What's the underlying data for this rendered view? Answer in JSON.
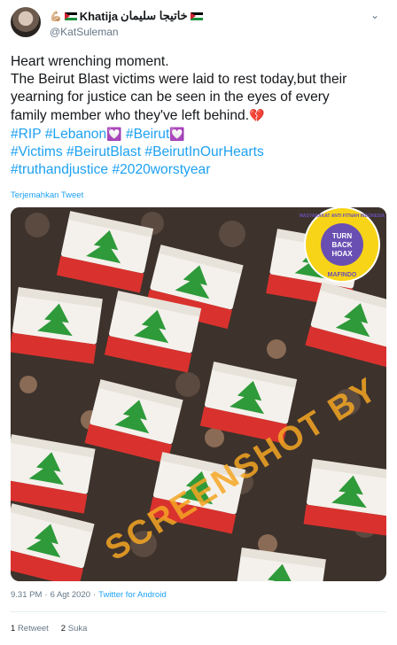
{
  "user": {
    "display_name": "Khatija",
    "display_name_arabic": "خاتيجا سليمان",
    "handle": "@KatSuleman"
  },
  "tweet": {
    "lines": [
      "Heart wrenching moment.",
      "The Beirut Blast victims were laid to rest today,but their",
      "yearning for justice can be seen in the eyes of every",
      "family member who they've left behind."
    ],
    "hashtags_line1": [
      "#RIP",
      "#Lebanon",
      "#Beirut"
    ],
    "hashtags_line2": [
      "#Victims",
      "#BeirutBlast",
      "#BeirutInOurHearts"
    ],
    "hashtags_line3": [
      "#truthandjustice",
      "#2020worstyear"
    ],
    "translate_label": "Terjemahkan Tweet"
  },
  "media": {
    "watermark": "SCREENSHOT BY",
    "stamp_ring_text": "MASYARAKAT ANTI FITNAH INDONESIA",
    "stamp_center": [
      "TURN",
      "BACK",
      "HOAX"
    ],
    "stamp_bottom": "MAFINDO",
    "colors": {
      "watermark": "#f5a623",
      "stamp": "#f7d417",
      "stamp_inner": "#6a4fb3",
      "cedar": "#2e9a3a",
      "flag_red": "#d9322e"
    }
  },
  "meta": {
    "time": "9.31 PM",
    "date": "6 Agt 2020",
    "client": "Twitter for Android"
  },
  "stats": {
    "retweets_count": "1",
    "retweets_label": "Retweet",
    "likes_count": "2",
    "likes_label": "Suka"
  },
  "icons": [
    "avatar",
    "palestine-flag-icon",
    "strong-arm-emoji-icon",
    "chevron-down-icon",
    "broken-heart-icon",
    "heart-emoji-icon",
    "lebanon-flag-emoji-icon"
  ]
}
